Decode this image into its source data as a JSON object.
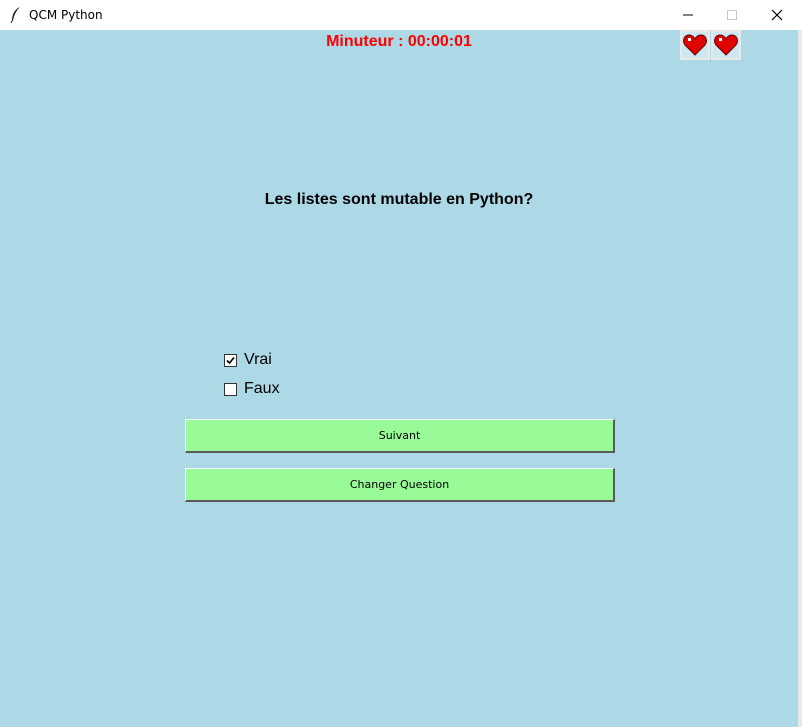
{
  "window": {
    "title": "QCM Python",
    "icon": "feather-icon",
    "controls": [
      "minimize-icon",
      "maximize-icon",
      "close-icon"
    ]
  },
  "header": {
    "timer_text": "Minuteur : 00:00:01",
    "timer_color": "#ff0000",
    "lives": [
      "heart-icon",
      "heart-icon"
    ]
  },
  "quiz": {
    "question": "Les listes sont mutable en Python?",
    "options": [
      {
        "label": "Vrai",
        "checked": true
      },
      {
        "label": "Faux",
        "checked": false
      }
    ]
  },
  "actions": {
    "next_label": "Suivant",
    "change_label": "Changer Question",
    "button_color": "#98fb98"
  },
  "colors": {
    "background": "#add8e6"
  }
}
